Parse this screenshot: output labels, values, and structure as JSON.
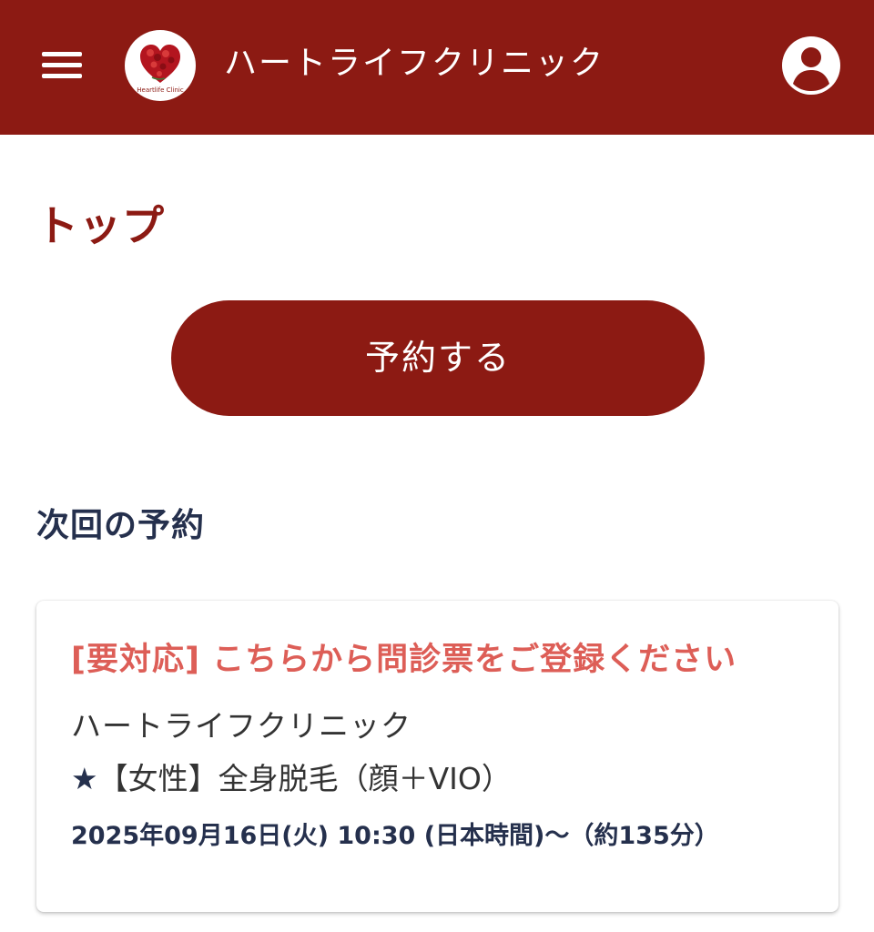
{
  "header": {
    "title": "ハートライフクリニック",
    "menu_icon": "hamburger-menu-icon",
    "logo_icon": "heart-logo-icon",
    "logo_text": "Heartlife Clinic",
    "account_icon": "account-circle-icon",
    "background_color": "#8c1a13"
  },
  "page": {
    "title": "トップ"
  },
  "actions": {
    "reserve_label": "予約する"
  },
  "next_reservation": {
    "section_title": "次回の予約",
    "alert_text": "[要対応] こちらから問診票をご登録ください",
    "clinic_name": "ハートライフクリニック",
    "menu_star": "★",
    "menu_name": "【女性】全身脱毛（顔＋VIO）",
    "datetime": "2025年09月16日(火) 10:30 (日本時間)〜（約135分）"
  },
  "colors": {
    "primary": "#8c1a13",
    "alert": "#dd5e57",
    "heading": "#25304d",
    "text": "#333333"
  }
}
